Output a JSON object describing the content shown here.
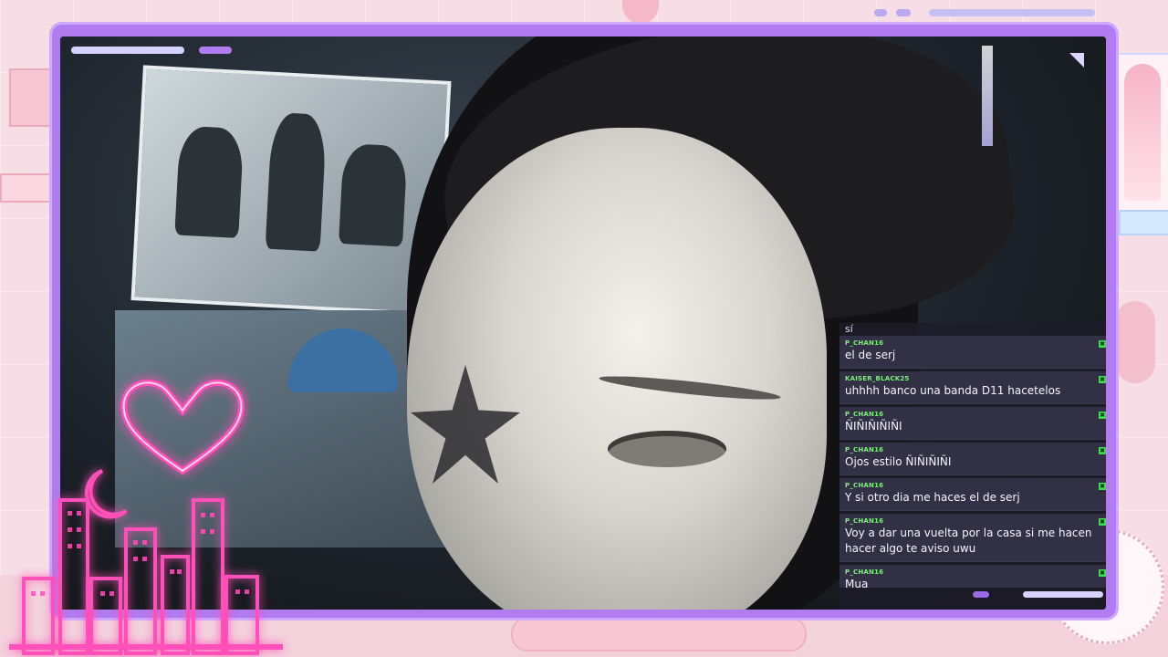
{
  "stream": {
    "chat_partial_top": "sí",
    "messages": [
      {
        "user": "P_CHAN16",
        "text": "el de serj"
      },
      {
        "user": "KAISER_BLACK25",
        "text": "uhhhh banco una banda D11 hacetelos"
      },
      {
        "user": "P_CHAN16",
        "text": "ÑIÑIÑIÑIÑI"
      },
      {
        "user": "P_CHAN16",
        "text": "Ojos estilo ÑIÑIÑIÑI"
      },
      {
        "user": "P_CHAN16",
        "text": "Y si otro dia me haces el de serj"
      },
      {
        "user": "P_CHAN16",
        "text": "Voy a dar una vuelta por la casa si me hacen hacer algo te aviso uwu"
      },
      {
        "user": "P_CHAN16",
        "text": "Mua"
      }
    ],
    "badge_icon": "moderator-badge-icon",
    "badge_glyph": "✖"
  },
  "colors": {
    "frame": "#b07cf0",
    "username": "#7cf17a",
    "neon": "#ff4fb8",
    "background": "#f6dde6"
  },
  "overlay": {
    "heart_icon": "neon-heart-icon",
    "moon_icon": "neon-moon-icon",
    "city_icon": "neon-city-skyline-icon"
  }
}
